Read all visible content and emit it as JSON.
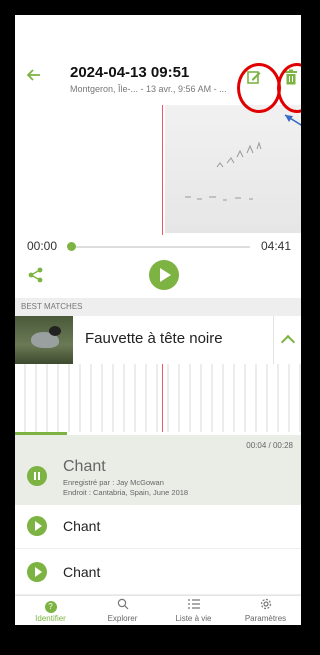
{
  "header": {
    "title": "2024-04-13 09:51",
    "subtitle": "Montgeron, Île-... - 13 avr., 9:56 AM - ...",
    "back_icon": "arrow-left-icon",
    "edit_icon": "edit-icon",
    "delete_icon": "trash-icon"
  },
  "player": {
    "time_start": "00:00",
    "time_end": "04:41",
    "share_icon": "share-icon",
    "play_icon": "play-icon"
  },
  "best_matches": {
    "label": "BEST MATCHES",
    "species": "Fauvette à tête noire"
  },
  "selected_recording": {
    "time": "00:04 / 00:28",
    "title": "Chant",
    "recorded_by": "Enregistré par : Jay McGowan",
    "location": "Endroit : Cantabria, Spain, June 2018"
  },
  "recordings": [
    {
      "title": "Chant"
    },
    {
      "title": "Chant"
    }
  ],
  "nav": [
    {
      "label": "Identifier",
      "icon": "help-icon",
      "active": true
    },
    {
      "label": "Explorer",
      "icon": "search-icon",
      "active": false
    },
    {
      "label": "Liste à vie",
      "icon": "list-icon",
      "active": false
    },
    {
      "label": "Paramètres",
      "icon": "gear-icon",
      "active": false
    }
  ],
  "colors": {
    "accent": "#7cb342",
    "annotation": "#e00000",
    "arrow": "#3a6bc4"
  }
}
